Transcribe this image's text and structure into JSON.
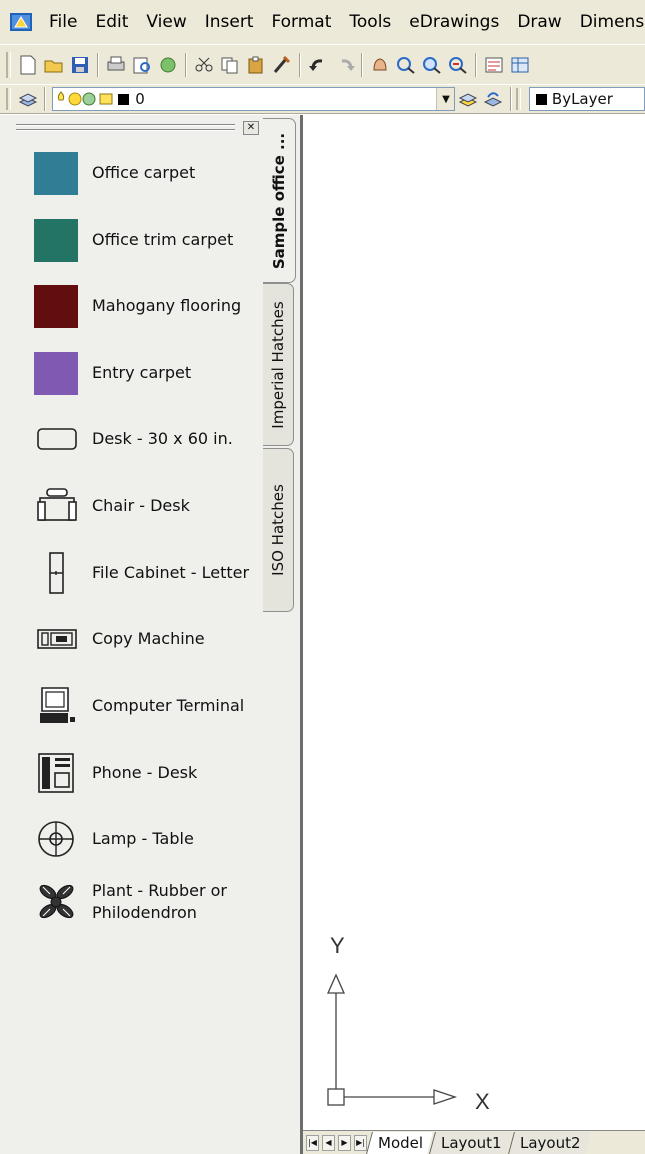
{
  "menubar": {
    "items": [
      "File",
      "Edit",
      "View",
      "Insert",
      "Format",
      "Tools",
      "eDrawings",
      "Draw",
      "Dimensio"
    ]
  },
  "layer_toolbar": {
    "layer_name": "0",
    "color_value": "ByLayer"
  },
  "palette": {
    "items": [
      {
        "label": "Office carpet",
        "icon": "swatch",
        "color": "#2f7e96"
      },
      {
        "label": "Office trim carpet",
        "icon": "swatch",
        "color": "#237465"
      },
      {
        "label": "Mahogany flooring",
        "icon": "swatch",
        "color": "#620e0e"
      },
      {
        "label": "Entry carpet",
        "icon": "swatch",
        "color": "#8059b2"
      },
      {
        "label": "Desk - 30 x 60 in.",
        "icon": "desk-icon"
      },
      {
        "label": "Chair - Desk",
        "icon": "chair-icon"
      },
      {
        "label": "File Cabinet - Letter",
        "icon": "file-cabinet-icon"
      },
      {
        "label": "Copy Machine",
        "icon": "copy-machine-icon"
      },
      {
        "label": "Computer Terminal",
        "icon": "computer-terminal-icon"
      },
      {
        "label": "Phone - Desk",
        "icon": "phone-icon"
      },
      {
        "label": "Lamp - Table",
        "icon": "lamp-icon"
      },
      {
        "label": "Plant - Rubber or Philodendron",
        "icon": "plant-icon"
      }
    ],
    "tabs": [
      "Sample office ...",
      "Imperial Hatches",
      "ISO Hatches"
    ],
    "active_tab": "Sample office ..."
  },
  "ucs": {
    "x_label": "X",
    "y_label": "Y"
  },
  "layout_tabs": {
    "items": [
      "Model",
      "Layout1",
      "Layout2"
    ],
    "active": "Model"
  }
}
